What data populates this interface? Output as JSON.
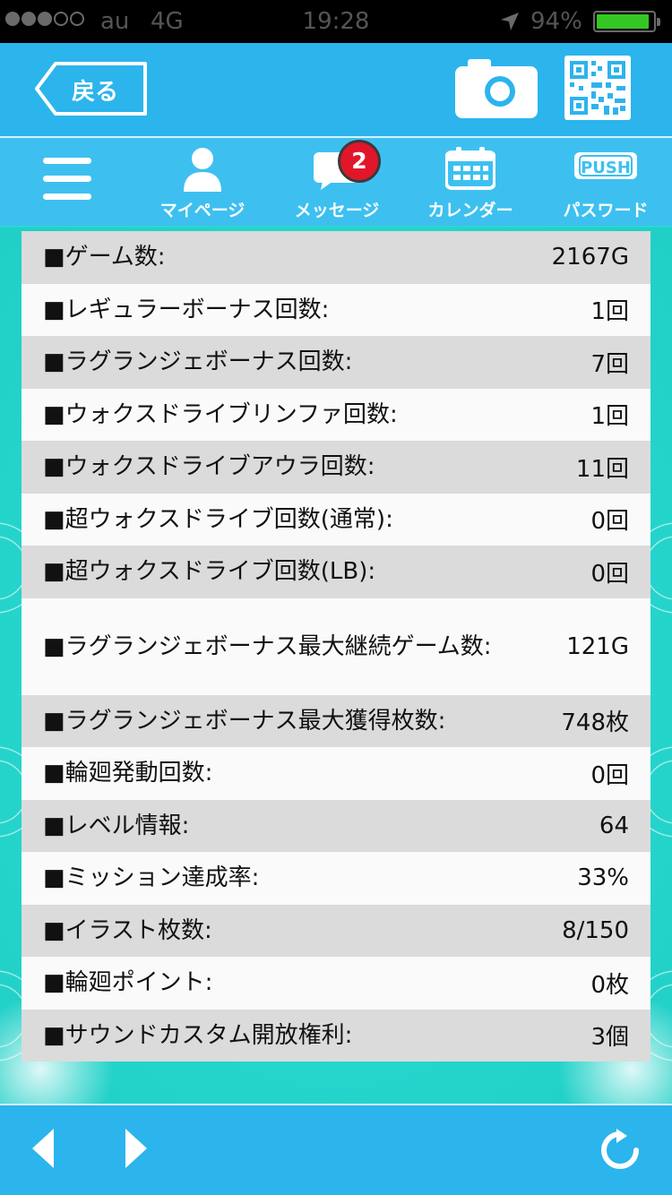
{
  "status_bar": {
    "carrier": "au",
    "network": "4G",
    "time": "19:28",
    "battery_percent": "94%",
    "signal_bars": 3,
    "battery_level": 0.94
  },
  "header": {
    "back_label": "戻る",
    "camera_icon": "camera-icon",
    "qr_icon": "qr-code-icon"
  },
  "nav": {
    "menu_icon": "hamburger-menu-icon",
    "items": [
      {
        "label": "マイページ",
        "icon": "person-icon"
      },
      {
        "label": "メッセージ",
        "icon": "speech-bubble-icon",
        "badge": "2"
      },
      {
        "label": "カレンダー",
        "icon": "calendar-icon"
      },
      {
        "label": "パスワード",
        "icon": "push-icon",
        "icon_text": "PUSH"
      }
    ]
  },
  "stats": [
    {
      "label": "■ゲーム数:",
      "value": "2167G"
    },
    {
      "label": "■レギュラーボーナス回数:",
      "value": "1回"
    },
    {
      "label": "■ラグランジェボーナス回数:",
      "value": "7回"
    },
    {
      "label": "■ウォクスドライブリンファ回数:",
      "value": "1回"
    },
    {
      "label": "■ウォクスドライブアウラ回数:",
      "value": "11回"
    },
    {
      "label": "■超ウォクスドライブ回数(通常):",
      "value": "0回"
    },
    {
      "label": "■超ウォクスドライブ回数(LB):",
      "value": "0回"
    },
    {
      "label": "■ラグランジェボーナス最大継続ゲーム数:",
      "value": "121G"
    },
    {
      "label": "■ラグランジェボーナス最大獲得枚数:",
      "value": "748枚"
    },
    {
      "label": "■輪廻発動回数:",
      "value": "0回"
    },
    {
      "label": "■レベル情報:",
      "value": "64"
    },
    {
      "label": "■ミッション達成率:",
      "value": "33%"
    },
    {
      "label": "■イラスト枚数:",
      "value": "8/150"
    },
    {
      "label": "■輪廻ポイント:",
      "value": "0枚"
    },
    {
      "label": "■サウンドカスタム開放権利:",
      "value": "3個"
    }
  ],
  "bottom_bar": {
    "back_icon": "arrow-left-icon",
    "forward_icon": "arrow-right-icon",
    "reload_icon": "reload-icon"
  },
  "colors": {
    "header_blue": "#2cb4ec",
    "nav_blue": "#3dc0f0",
    "background_teal": "#2ad8cf",
    "row_dark": "#dbdbdb",
    "row_light": "#fafafa",
    "badge_red": "#e2162a",
    "battery_green": "#34c724"
  }
}
